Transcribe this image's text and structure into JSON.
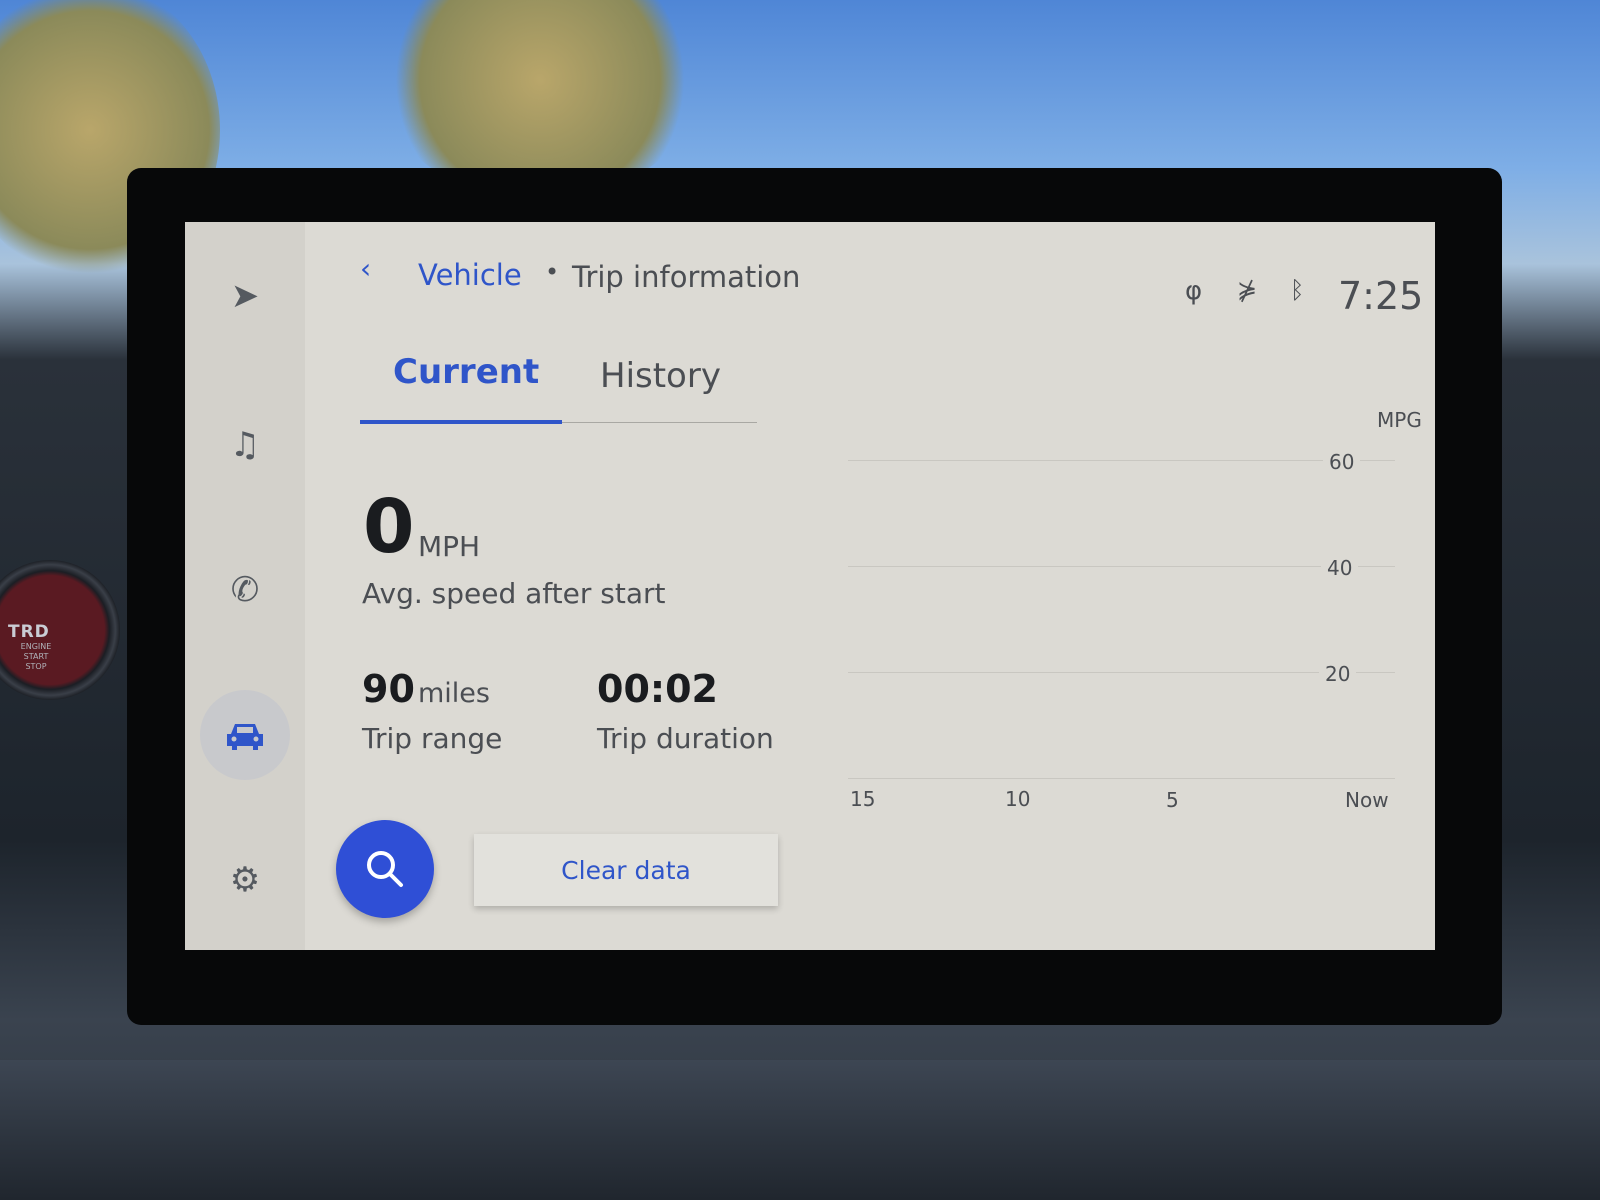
{
  "header": {
    "back_icon": "chevron-left-icon",
    "breadcrumb_parent": "Vehicle",
    "separator": "•",
    "breadcrumb_current": "Trip information"
  },
  "status": {
    "icons": [
      "wireless-charging-icon",
      "voice-disabled-icon",
      "bluetooth-icon"
    ],
    "time": "7:25"
  },
  "sidebar": {
    "items": [
      {
        "icon": "navigation-icon"
      },
      {
        "icon": "music-icon"
      },
      {
        "icon": "phone-icon"
      },
      {
        "icon": "car-icon",
        "selected": true
      },
      {
        "icon": "settings-icon"
      }
    ]
  },
  "tabs": [
    {
      "label": "Current",
      "active": true
    },
    {
      "label": "History",
      "active": false
    }
  ],
  "stats": {
    "avg_speed_value": "0",
    "avg_speed_unit": "MPH",
    "avg_speed_label": "Avg. speed after start",
    "range_value": "90",
    "range_unit": "miles",
    "range_label": "Trip range",
    "duration_value": "00:02",
    "duration_label": "Trip duration"
  },
  "actions": {
    "search_icon": "search-icon",
    "clear_label": "Clear data"
  },
  "chart": {
    "type": "line",
    "ylabel": "MPG",
    "y_ticks": [
      "60",
      "40",
      "20"
    ],
    "ylim": [
      0,
      60
    ],
    "x_ticks": [
      "15",
      "10",
      "5",
      "Now"
    ],
    "series": [],
    "grid": true
  },
  "car": {
    "start_button_brand": "TRD",
    "start_button_text": "ENGINE START STOP"
  },
  "colors": {
    "accent": "#2f55c9",
    "screen_bg": "#dcdad4"
  }
}
